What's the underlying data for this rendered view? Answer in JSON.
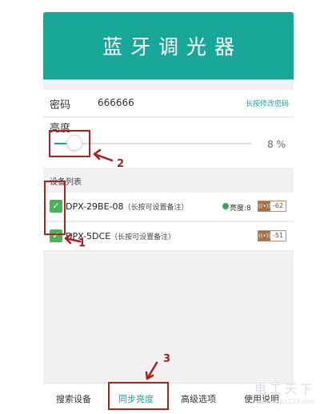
{
  "app": {
    "title": "蓝牙调光器"
  },
  "password": {
    "label": "密码",
    "value": "666666",
    "change_link": "长按修改密码"
  },
  "brightness": {
    "label": "亮度",
    "value_text": "8 %",
    "level_fraction": 0.08
  },
  "device_list": {
    "header": "设备列表",
    "devices": [
      {
        "name": "DPX-29BE-08",
        "note": "（长按可设置备注）",
        "brightness_text": "亮度:8",
        "signal": "-62",
        "checked": true
      },
      {
        "name": "DPX-5DCE",
        "note": "（长按可设置备注）",
        "brightness_text": "",
        "signal": "-51",
        "checked": true
      }
    ]
  },
  "tabs": [
    {
      "label": "搜索设备",
      "active": false
    },
    {
      "label": "同步亮度",
      "active": true
    },
    {
      "label": "高级选项",
      "active": false
    },
    {
      "label": "使用说明",
      "active": false
    }
  ],
  "annotations": {
    "marker1": "1",
    "marker2": "2",
    "marker3": "3"
  },
  "watermark": {
    "text": "电工天下",
    "url": "www.dgtx123.com"
  },
  "colors": {
    "brand": "#19a79a",
    "checkbox": "#4bb25a",
    "annotation": "#b02121",
    "signal": "#a4704a"
  },
  "icons": {
    "check": "check-icon",
    "bulb": "bulb-icon",
    "signal": "signal-icon"
  }
}
